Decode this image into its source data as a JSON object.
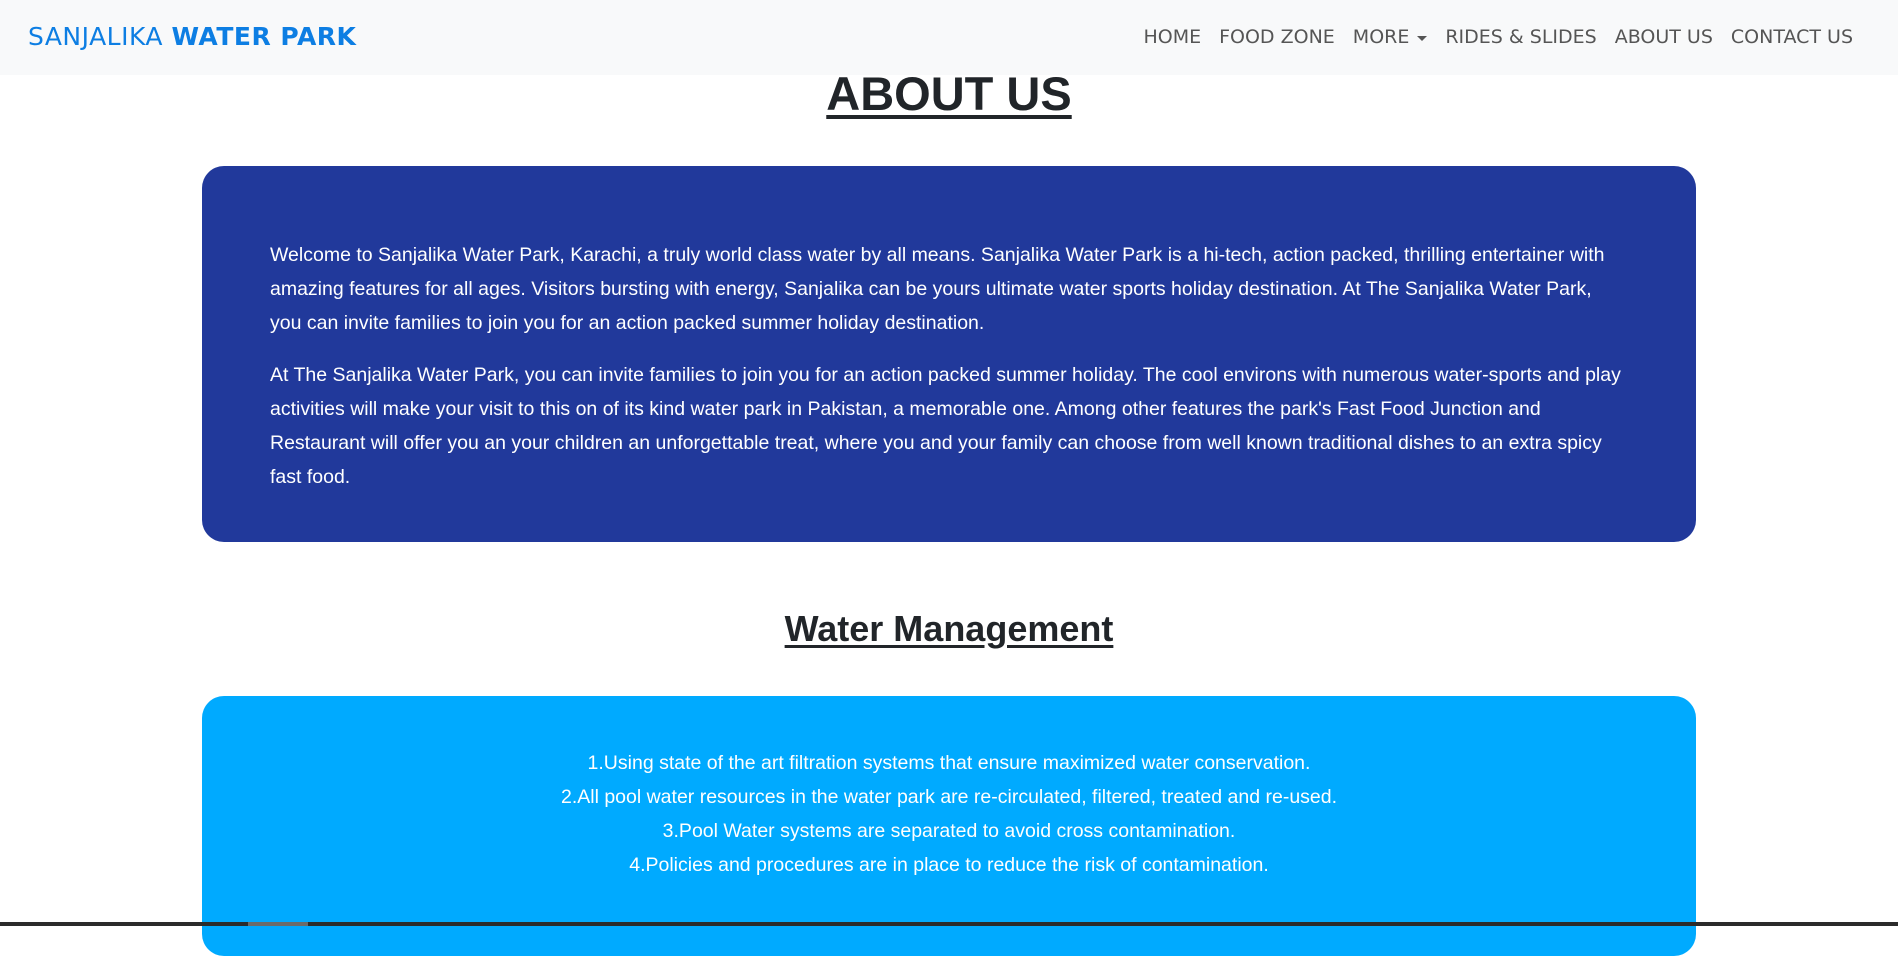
{
  "navbar": {
    "brand_light": "SANJALIKA",
    "brand_bold": "WATER PARK",
    "links": [
      {
        "label": "HOME"
      },
      {
        "label": "FOOD ZONE"
      },
      {
        "label": "MORE"
      },
      {
        "label": "RIDES & SLIDES"
      },
      {
        "label": "ABOUT US"
      },
      {
        "label": "CONTACT US"
      }
    ]
  },
  "about": {
    "title": "ABOUT US",
    "paragraphs": [
      "Welcome to Sanjalika Water Park, Karachi, a truly world class water by all means. Sanjalika Water Park is a hi-tech, action packed, thrilling entertainer with amazing features for all ages. Visitors bursting with energy, Sanjalika can be yours ultimate water sports holiday destination. At The Sanjalika Water Park, you can invite families to join you for an action packed summer holiday destination.",
      "At The Sanjalika Water Park, you can invite families to join you for an action packed summer holiday. The cool environs with numerous water-sports and play activities will make your visit to this on of its kind water park in Pakistan, a memorable one. Among other features the park's Fast Food Junction and Restaurant will offer you an your children an unforgettable treat, where you and your family can choose from well known traditional dishes to an extra spicy fast food."
    ]
  },
  "water_management": {
    "title": "Water Management",
    "items": [
      "1.Using state of the art filtration systems that ensure maximized water conservation.",
      "2.All pool water resources in the water park are re-circulated, filtered, treated and re-used.",
      "3.Pool Water systems are separated to avoid cross contamination.",
      "4.Policies and procedures are in place to reduce the risk of contamination."
    ]
  },
  "colors": {
    "brand": "#0d7ee3",
    "about_card": "#21399b",
    "water_card": "#00aaff",
    "navbar_bg": "#f8f9fa"
  }
}
